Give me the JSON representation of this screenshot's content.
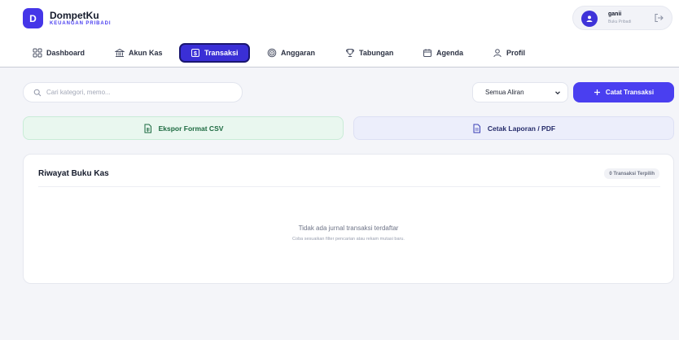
{
  "brand": {
    "logo_letter": "D",
    "name": "DompetKu",
    "subtitle": "KEUANGAN PRIBADI",
    "accent": "#4a3ff0"
  },
  "user": {
    "name": "ganii",
    "role": "Buku Pribadi",
    "avatar_icon": "user-icon",
    "logout_icon": "logout-icon"
  },
  "nav": {
    "items": [
      {
        "label": "Dashboard",
        "icon": "grid-icon",
        "active": false
      },
      {
        "label": "Akun Kas",
        "icon": "bank-icon",
        "active": false
      },
      {
        "label": "Transaksi",
        "icon": "dollar-box-icon",
        "active": true
      },
      {
        "label": "Anggaran",
        "icon": "target-icon",
        "active": false
      },
      {
        "label": "Tabungan",
        "icon": "trophy-icon",
        "active": false
      },
      {
        "label": "Agenda",
        "icon": "calendar-icon",
        "active": false
      },
      {
        "label": "Profil",
        "icon": "user-icon",
        "active": false
      }
    ]
  },
  "toolbar": {
    "search_placeholder": "Cari kategori, memo...",
    "filter_selected": "Semua Aliran",
    "add_button": "Catat Transaksi"
  },
  "export": {
    "csv_label": "Ekspor Format CSV",
    "pdf_label": "Cetak Laporan / PDF"
  },
  "history": {
    "title": "Riwayat Buku Kas",
    "count_badge": "0 Transaksi Terpilih",
    "empty_title": "Tidak ada jurnal transaksi terdaftar",
    "empty_subtitle": "Coba sesuaikan filter pencarian atau rekam mutasi baru."
  }
}
